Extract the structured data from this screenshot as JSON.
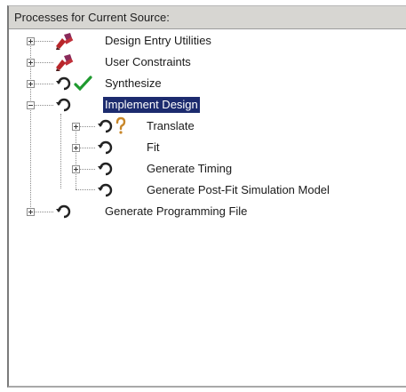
{
  "panel": {
    "title": "Processes for Current Source:"
  },
  "tree": {
    "items": [
      {
        "label": "Design Entry Utilities",
        "icon": "design-tools-icon",
        "status": ""
      },
      {
        "label": "User Constraints",
        "icon": "design-tools-icon",
        "status": ""
      },
      {
        "label": "Synthesize",
        "icon": "process-icon",
        "status": "check-icon"
      },
      {
        "label": "Implement Design",
        "icon": "process-icon",
        "status": "",
        "selected": true
      },
      {
        "label": "Translate",
        "icon": "process-icon",
        "status": "question-icon"
      },
      {
        "label": "Fit",
        "icon": "process-icon",
        "status": ""
      },
      {
        "label": "Generate Timing",
        "icon": "process-icon",
        "status": ""
      },
      {
        "label": "Generate Post-Fit Simulation Model",
        "icon": "process-icon",
        "status": ""
      },
      {
        "label": "Generate Programming File",
        "icon": "process-icon",
        "status": ""
      }
    ]
  },
  "colors": {
    "selection": "#1c2b6e",
    "check": "#1f9a2f",
    "question": "#c8872a",
    "design_tool_red": "#b8262a"
  }
}
